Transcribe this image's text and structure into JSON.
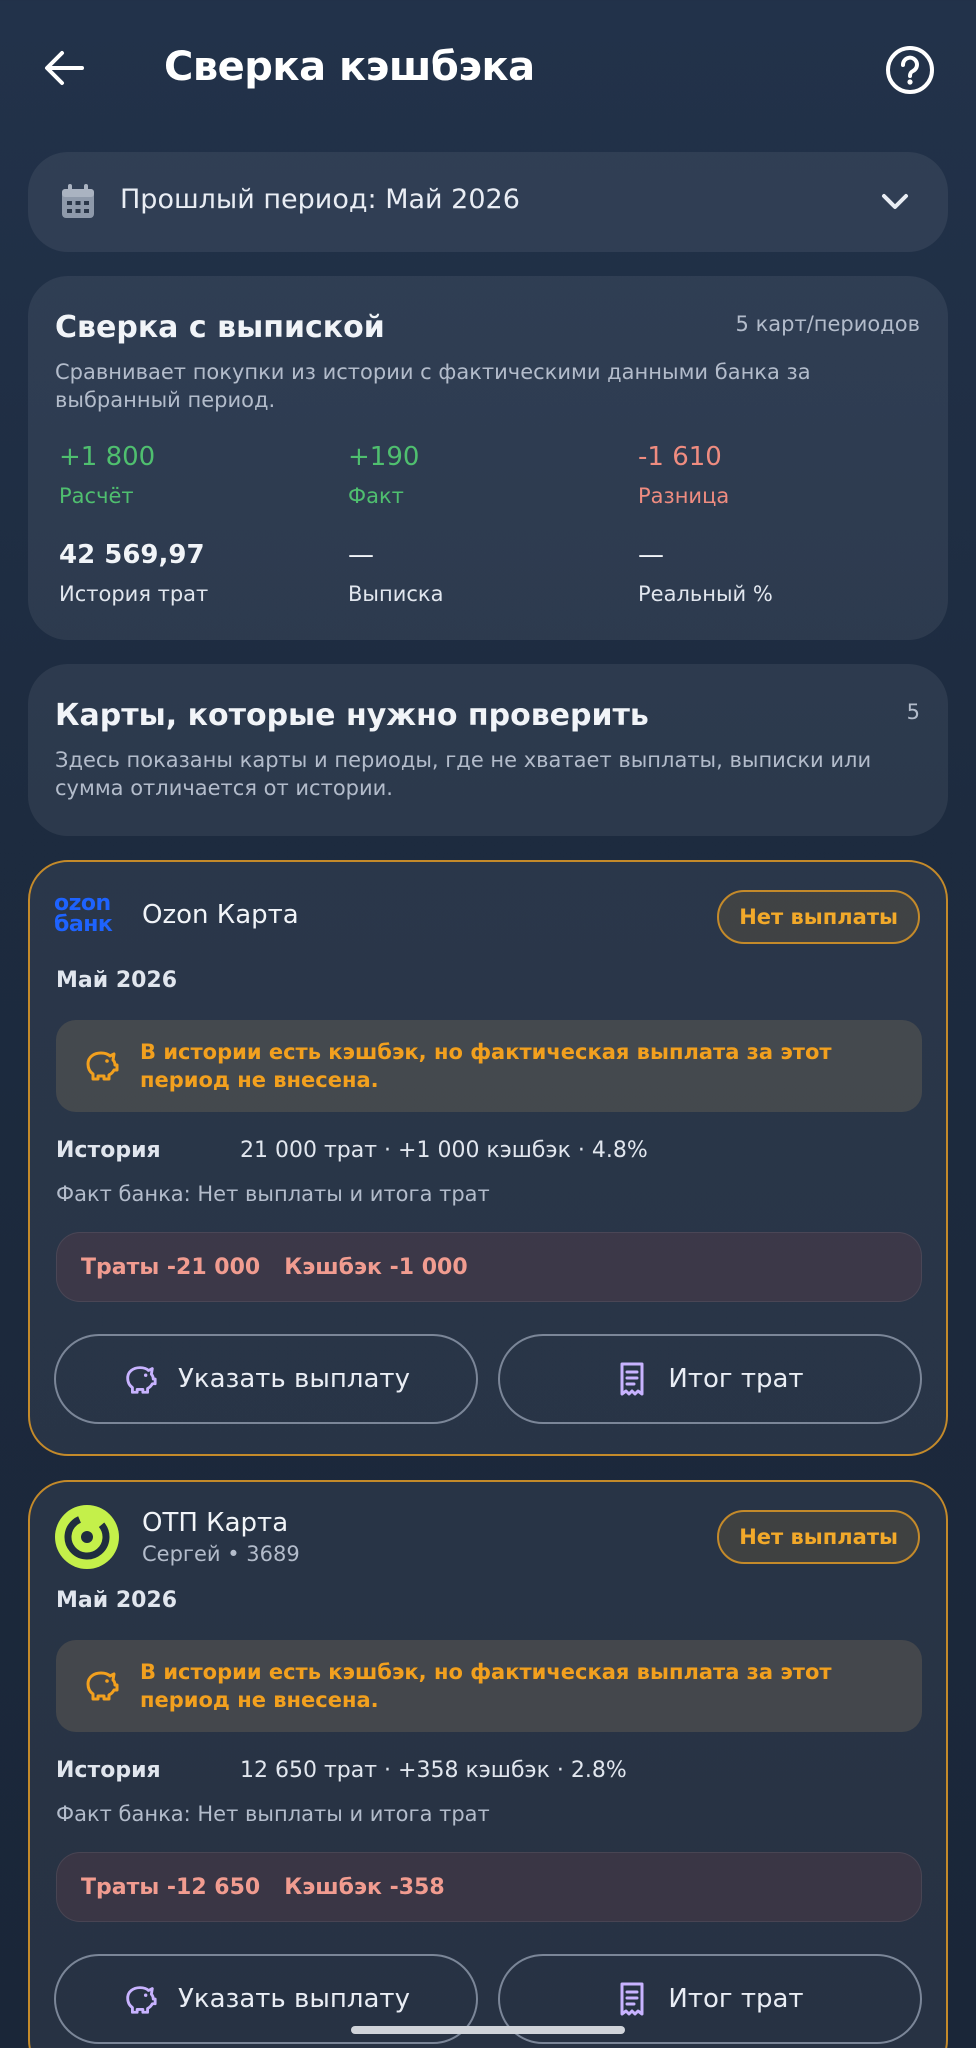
{
  "header": {
    "title": "Сверка кэшбэка"
  },
  "period_selector": {
    "label": "Прошлый период: Май 2026"
  },
  "summary": {
    "title": "Сверка с выпиской",
    "count": "5 карт/периодов",
    "description": "Сравнивает покупки из истории с фактическими данными банка за выбранный период.",
    "stats": [
      {
        "value": "+1 800",
        "label": "Расчёт"
      },
      {
        "value": "+190",
        "label": "Факт"
      },
      {
        "value": "-1 610",
        "label": "Разница"
      },
      {
        "value": "42 569,97",
        "label": "История трат"
      },
      {
        "value": "—",
        "label": "Выписка"
      },
      {
        "value": "—",
        "label": "Реальный %"
      }
    ],
    "colors": {
      "positive": "#4fbf6f",
      "negative": "#ef8c80"
    }
  },
  "check_section": {
    "title": "Карты, которые нужно проверить",
    "count": "5",
    "description": "Здесь показаны карты и периоды, где не хватает выплаты, выписки или сумма отличается от истории."
  },
  "cards": [
    {
      "logo_top": "ozon",
      "logo_bottom": "банк",
      "name": "Ozon Карта",
      "badge": "Нет выплаты",
      "period": "Май 2026",
      "warning": "В истории есть кэшбэк, но фактическая выплата за этот период не внесена.",
      "history_label": "История",
      "history_value": "21 000 трат · +1 000 кэшбэк · 4.8%",
      "bank_fact": "Факт банка: Нет выплаты и итога трат",
      "diff_spend": "Траты -21 000",
      "diff_cashback": "Кэшбэк -1 000",
      "btn_payout": "Указать выплату",
      "btn_total": "Итог трат"
    },
    {
      "name": "ОТП Карта",
      "sub": "Сергей • 3689",
      "badge": "Нет выплаты",
      "period": "Май 2026",
      "warning": "В истории есть кэшбэк, но фактическая выплата за этот период не внесена.",
      "history_label": "История",
      "history_value": "12 650 трат · +358 кэшбэк · 2.8%",
      "bank_fact": "Факт банка: Нет выплаты и итога трат",
      "diff_spend": "Траты -12 650",
      "diff_cashback": "Кэшбэк -358",
      "btn_payout": "Указать выплату",
      "btn_total": "Итог трат"
    }
  ],
  "accent": "#c48a2a"
}
